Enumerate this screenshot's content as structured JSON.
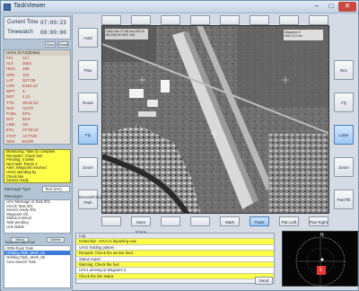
{
  "window": {
    "title": "TaskViewer"
  },
  "clock": {
    "current_time_label": "Current Time",
    "current_time_value": "07:00:23",
    "timewatch_label": "Timewatch",
    "timewatch_value": "00:00:00",
    "btn_start": "Start",
    "btn_reset": "Reset"
  },
  "datatable": {
    "header": "UAV1 (CAS)(Data)",
    "rows": [
      {
        "k": "FFL",
        "v": "317"
      },
      {
        "k": "ALT",
        "v": "2064"
      },
      {
        "k": "HDG",
        "v": "108"
      },
      {
        "k": "SPD",
        "v": "110"
      },
      {
        "k": "LAT",
        "v": "S27.08"
      },
      {
        "k": "LON",
        "v": "E153.10"
      },
      {
        "k": "WPT",
        "v": "3"
      },
      {
        "k": "DST",
        "v": "4.21"
      },
      {
        "k": "TTG",
        "v": "00:02:10"
      },
      {
        "k": "NAV",
        "v": "AUTO"
      },
      {
        "k": "FUEL",
        "v": "82%"
      },
      {
        "k": "BAT",
        "v": "91%"
      },
      {
        "k": "LINK",
        "v": "OK"
      },
      {
        "k": "ETA",
        "v": "07:03:10"
      },
      {
        "k": "STAT",
        "v": "ACTIVE"
      },
      {
        "k": "SEN",
        "v": "EO/IR"
      }
    ]
  },
  "alerts": [
    "Monitoring: Task 01 complete",
    "Reminder: Check fuel",
    "Pending: 3 tasks",
    "Next task: Route 2",
    "Alert: Waypoint reached",
    "UAV2 standing by",
    "Check link",
    "Sensor ready"
  ],
  "message_type": {
    "label": "Message Type",
    "value": "Text (HV)"
  },
  "history_label": "Messages",
  "history": [
    "UAV Message of Task 001",
    "Check Task 001",
    "Sensor ready 001",
    "Waypoint OK",
    "Status nominal",
    "Task pending",
    "Link stable"
  ],
  "pair_buttons": [
    "Send",
    "Delete"
  ],
  "tasks_label": "Tasks for UAV Path",
  "tasks": [
    {
      "text": "ORB-Ryan Task",
      "selected": false
    },
    {
      "text": "Orbiting Task_MAR_04",
      "selected": true
    },
    {
      "text": "Orbiting Task_MAR_05",
      "selected": false
    },
    {
      "text": "Area Search Task",
      "selected": false
    }
  ],
  "side_buttons": {
    "left": [
      "Hold",
      "Plan",
      "Route",
      "Fly",
      "Zoom",
      "Record/Clear Path"
    ],
    "right": [
      "Rec",
      "Fly",
      "Loiter",
      "Zoom",
      "Pan/Tilt",
      "Stabilize"
    ]
  },
  "bottom_buttons": [
    "Save Image",
    "Mark",
    "Track",
    "Pan Left",
    "Pan Right"
  ],
  "map_info": {
    "line1": "UAV1 lat:-27.08 lon:153.10",
    "line2": "Alt 2064 ft  HDG 108"
  },
  "map_info2": {
    "line1": "Waypoint 3",
    "line2": "Dist 4.21 km"
  },
  "messages": [
    {
      "text": "Log",
      "style": "h"
    },
    {
      "text": "Instruction: UAV1 is departing now",
      "style": "y"
    },
    {
      "text": "UAV2 holding pattern",
      "style": "w"
    },
    {
      "text": "Request: Check the sensor feed",
      "style": "y"
    },
    {
      "text": "Status report",
      "style": "w"
    },
    {
      "text": "Warning: Check the fuel",
      "style": "y"
    },
    {
      "text": "UAV1 arriving at Waypoint 3",
      "style": "w"
    },
    {
      "text": "Check the link status",
      "style": "y"
    }
  ],
  "send_btn": "Send",
  "radar": {
    "north": "N",
    "contact": "1"
  },
  "colors": {
    "alert_yellow": "#ffff4a",
    "selection_blue": "#3d7dd8",
    "radar_target": "#e8383a"
  }
}
